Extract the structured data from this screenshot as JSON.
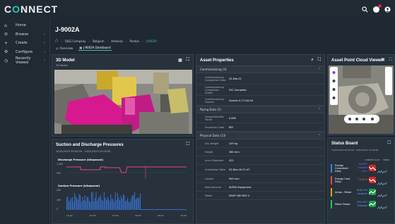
{
  "app": {
    "logo": "CONNECT"
  },
  "topbar": {
    "icons": [
      "search-icon",
      "user-icon",
      "account-icon"
    ]
  },
  "sidebar": {
    "items": [
      {
        "label": "Home",
        "icon": "home-icon",
        "chevron": false
      },
      {
        "label": "Browse",
        "icon": "browse-icon",
        "chevron": true
      },
      {
        "label": "Create",
        "icon": "plus-icon",
        "chevron": true
      },
      {
        "label": "Configure",
        "icon": "gear-icon",
        "chevron": true
      },
      {
        "label": "Recently Viewed",
        "icon": "clock-icon",
        "chevron": true
      }
    ]
  },
  "page": {
    "title": "J-9002A",
    "breadcrumbs": [
      "O&G Company",
      "Belgium",
      "Antwerp",
      "Pumps",
      "J-9002A"
    ],
    "tabs": [
      {
        "label": "Overview",
        "active": false
      },
      {
        "label": "J-9002A Dashboard",
        "active": true
      }
    ]
  },
  "model": {
    "title": "3D Model",
    "subtitle": "3D Model"
  },
  "props": {
    "title": "Asset Properties",
    "sections": [
      {
        "label": "Commissioning (3)",
        "rows": [
          {
            "k": "Commissioning Completion Date",
            "v": "25-Mar-21"
          },
          {
            "k": "Commissioning Completion Status",
            "v": "SYC Complete"
          },
          {
            "k": "Commissioning System",
            "v": "System 0-77-AD-00"
          }
        ]
      },
      {
        "label": "Piping Data (2)",
        "rows": [
          {
            "k": "Compressibility Factor",
            "v": "0.859"
          },
          {
            "k": "Insulation Code",
            "v": "IED"
          }
        ]
      },
      {
        "label": "Physical Data (13)",
        "rows": [
          {
            "k": "Dry Weight",
            "v": "249 kg"
          },
          {
            "k": "Height",
            "v": "380 mm"
          },
          {
            "k": "Inner Diameter",
            "v": "422"
          },
          {
            "k": "Installation Date",
            "v": "02-Nov-16 21:47"
          },
          {
            "k": "Length",
            "v": "945 mm"
          },
          {
            "k": "Manufacturer",
            "v": "AVEVA Equipment"
          },
          {
            "k": "Model",
            "v": "NSHP 180 MLE 4"
          }
        ]
      }
    ]
  },
  "cloud": {
    "title": "Asset Point Cloud Viewer"
  },
  "suction": {
    "title": "Suction and Discharge Pressures",
    "range": "10/01/2023 00:00:00 - 10/01/2023 10:00:00",
    "charts": [
      {
        "label": "Discharge Pressure (kilopascal)",
        "ymax": "1,000",
        "ymid": "500"
      },
      {
        "label": "Suction Pressure (kilopascal)",
        "ymax": "200",
        "ymid": "100",
        "ymin": "0"
      }
    ],
    "xticks": [
      "10 Jan",
      "02:00",
      "04:00",
      "06:00",
      "08:00",
      "10:00"
    ]
  },
  "status": {
    "title": "Status Board",
    "range": "10/01/2023 00:00:00 - 10/01/2023 13:00:00",
    "col_value": "CURRENT VALUE",
    "col_trend": "TREND",
    "rows": [
      {
        "name": "Energy Consumed Daily",
        "value": "54,697 kilowatt hour",
        "color": "#8b5cf6",
        "bar": "#3b82f6",
        "trend": "down",
        "trendbg": "#dc2626"
      },
      {
        "name": "Energy Cost Daily",
        "value": "7,110.5",
        "color": "#f87171",
        "bar": "#ef4444",
        "trend": "down",
        "trendbg": "#dc2626"
      },
      {
        "name": "Amps - Motor",
        "value": "606.743 ampere",
        "color": "#60a5fa",
        "bar": "#f59e0b",
        "trend": "up",
        "trendbg": "#16a34a"
      },
      {
        "name": "Motor Power",
        "value": "291.257 kilowatt",
        "color": "#60a5fa",
        "bar": "#22c55e",
        "trend": "up",
        "trendbg": "#16a34a"
      }
    ]
  }
}
